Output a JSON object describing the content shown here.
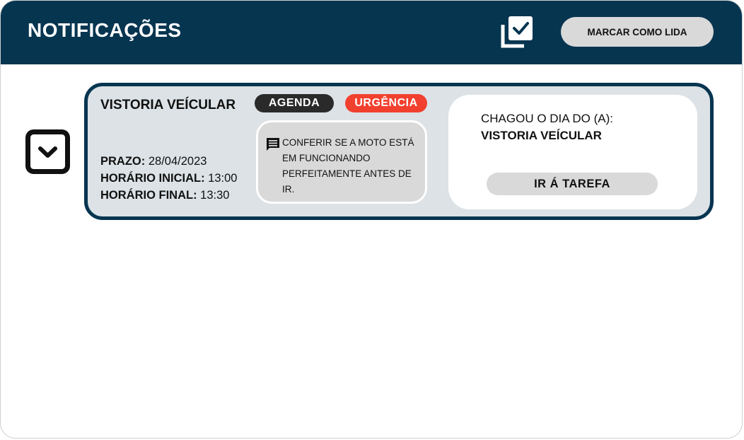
{
  "header": {
    "title": "NOTIFICAÇÕES",
    "mark_read_label": "MARCAR COMO LIDA",
    "mark_icon": "check-square-stack-icon"
  },
  "notification": {
    "title": "VISTORIA VEÍCULAR",
    "badges": {
      "agenda": "AGENDA",
      "urgency": "URGÊNCIA"
    },
    "deadline_label": "PRAZO:",
    "deadline_value": "28/04/2023",
    "start_label": "HORÁRIO INICIAL:",
    "start_value": "13:00",
    "end_label": "HORÁRIO FINAL:",
    "end_value": "13:30",
    "comment": "CONFERIR SE A MOTO ESTÁ EM FUNCIONANDO PERFEITAMENTE ANTES DE IR.",
    "reminder_line1": "CHAGOU O DIA DO (A):",
    "reminder_line2": "VISTORIA VEÍCULAR",
    "go_label": "IR Á TAREFA"
  },
  "colors": {
    "header_bg": "#063550",
    "card_bg": "#dce2e6",
    "badge_agenda": "#2a2a2a",
    "badge_urgency": "#f2402f",
    "button_bg": "#d9d9d9"
  }
}
